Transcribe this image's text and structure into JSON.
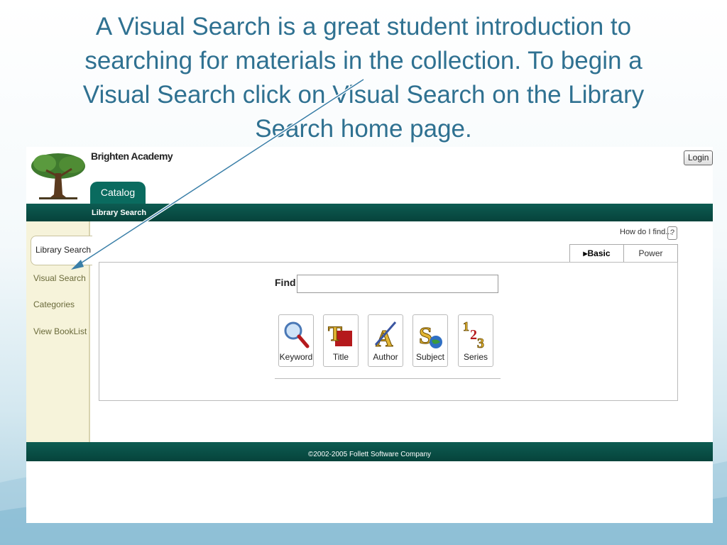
{
  "caption": {
    "line1": "A Visual Search is a great student introduction to",
    "line2": "searching for materials in the collection.  To begin a",
    "line3": "Visual Search click on Visual Search on the Library",
    "line4": "Search home page."
  },
  "header": {
    "school_name": "Brighten Academy",
    "login_label": "Login",
    "catalog_tab": "Catalog",
    "subnav_label": "Library Search"
  },
  "sidebar": {
    "items": [
      {
        "label": "Library Search",
        "active": true
      },
      {
        "label": "Visual Search"
      },
      {
        "label": "Categories"
      },
      {
        "label": "View BookList"
      }
    ]
  },
  "help": {
    "label": "How do I find...",
    "icon_text": "?"
  },
  "search_tabs": [
    {
      "label": "Basic",
      "active": true
    },
    {
      "label": "Power"
    }
  ],
  "search": {
    "find_label": "Find",
    "value": ""
  },
  "search_buttons": [
    {
      "label": "Keyword",
      "icon": "magnifier-icon"
    },
    {
      "label": "Title",
      "icon": "title-book-icon"
    },
    {
      "label": "Author",
      "icon": "author-quill-icon"
    },
    {
      "label": "Subject",
      "icon": "subject-globe-icon"
    },
    {
      "label": "Series",
      "icon": "series-numbers-icon"
    }
  ],
  "footer": {
    "copyright": "©2002-2005  Follett Software Company"
  },
  "colors": {
    "caption": "#2f7191",
    "green_bar": "#0a5a50",
    "sidebar_bg": "#f6f3da"
  }
}
